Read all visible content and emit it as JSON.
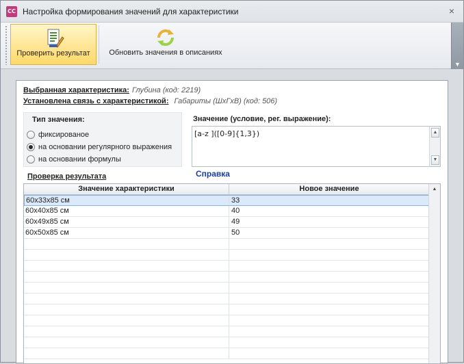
{
  "window": {
    "icon_text": "CC",
    "title": "Настройка формирования значений для характеристики",
    "close_glyph": "×"
  },
  "ribbon": {
    "check_button_label": "Проверить результат",
    "update_button_label": "Обновить значения в описаниях",
    "collapse_arrow": "▼"
  },
  "info": {
    "selected_label": "Выбранная характеристика:",
    "selected_value": "Глубина (код: 2219)",
    "link_label": "Установлена связь с характеристикой:",
    "link_value": "Габариты (ШхГхВ) (код: 506)"
  },
  "value_type": {
    "title": "Тип значения:",
    "options": [
      "фиксированое",
      "на основании регулярного выражения",
      "на основании формулы"
    ],
    "selected_index": 1
  },
  "value_input": {
    "title": "Значение (условие, рег. выражение):",
    "text": "[a-z ]([0-9]{1,3})"
  },
  "help_link": "Справка",
  "result": {
    "title": "Проверка результата",
    "columns": [
      "Значение характеристики",
      "Новое значение"
    ],
    "rows": [
      [
        "60x33x85 см",
        "33"
      ],
      [
        "60x40x85 см",
        "40"
      ],
      [
        "60x49x85 см",
        "49"
      ],
      [
        "60x50x85 см",
        "50"
      ]
    ],
    "selected_row": 0
  },
  "colors": {
    "accent_link": "#1a3f9e",
    "ribbon_active": "#ffd86a",
    "selection": "#dbeafa"
  }
}
